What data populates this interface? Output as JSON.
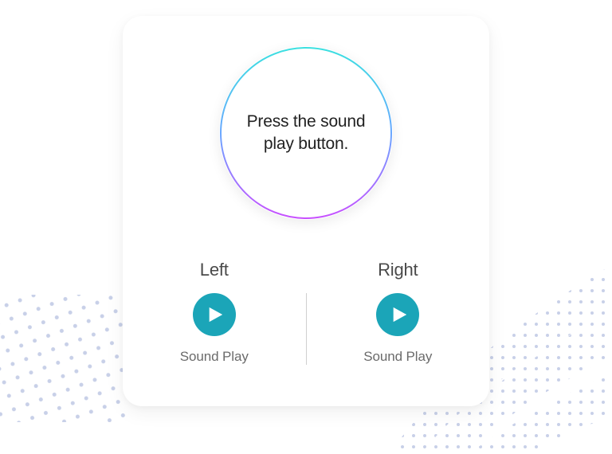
{
  "hero": {
    "message": "Press the sound play button."
  },
  "channels": {
    "left": {
      "label": "Left",
      "button_label": "Sound Play"
    },
    "right": {
      "label": "Right",
      "button_label": "Sound Play"
    }
  },
  "colors": {
    "play_button": "#1ba5b8",
    "circle_top": "#3be0e0",
    "circle_right": "#6aa8ff",
    "circle_bottom": "#c850ff"
  }
}
